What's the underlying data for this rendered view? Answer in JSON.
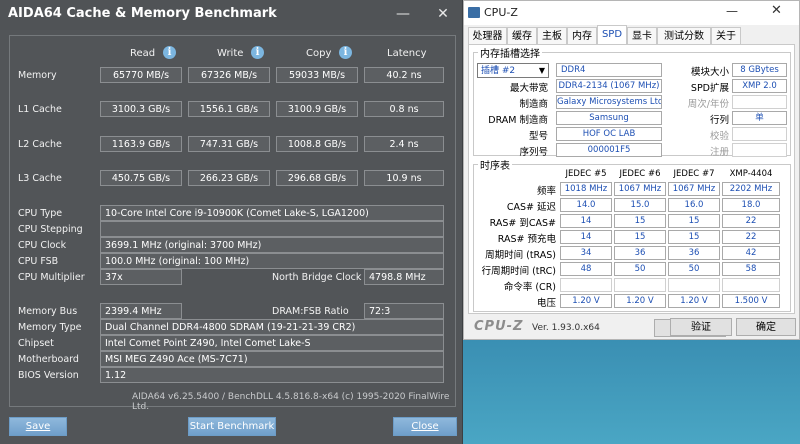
{
  "aida": {
    "title": "AIDA64 Cache & Memory Benchmark",
    "columns": {
      "read": "Read",
      "write": "Write",
      "copy": "Copy",
      "latency": "Latency"
    },
    "bench_rows": [
      {
        "label": "Memory",
        "read": "65770 MB/s",
        "write": "67326 MB/s",
        "copy": "59033 MB/s",
        "latency": "40.2 ns"
      },
      {
        "label": "L1 Cache",
        "read": "3100.3 GB/s",
        "write": "1556.1 GB/s",
        "copy": "3100.9 GB/s",
        "latency": "0.8 ns"
      },
      {
        "label": "L2 Cache",
        "read": "1163.9 GB/s",
        "write": "747.31 GB/s",
        "copy": "1008.8 GB/s",
        "latency": "2.4 ns"
      },
      {
        "label": "L3 Cache",
        "read": "450.75 GB/s",
        "write": "266.23 GB/s",
        "copy": "296.68 GB/s",
        "latency": "10.9 ns"
      }
    ],
    "cpu": {
      "type_label": "CPU Type",
      "type": "10-Core Intel Core i9-10900K  (Comet Lake-S, LGA1200)",
      "stepping_label": "CPU Stepping",
      "stepping": "",
      "clock_label": "CPU Clock",
      "clock": "3699.1 MHz  (original: 3700 MHz)",
      "fsb_label": "CPU FSB",
      "fsb": "100.0 MHz  (original: 100 MHz)",
      "mult_label": "CPU Multiplier",
      "mult": "37x",
      "nb_label": "North Bridge Clock",
      "nb": "4798.8 MHz"
    },
    "mem": {
      "bus_label": "Memory Bus",
      "bus": "2399.4 MHz",
      "ratio_label": "DRAM:FSB Ratio",
      "ratio": "72:3",
      "type_label": "Memory Type",
      "type": "Dual Channel DDR4-4800 SDRAM  (19-21-21-39 CR2)",
      "chipset_label": "Chipset",
      "chipset": "Intel Comet Point Z490, Intel Comet Lake-S",
      "mb_label": "Motherboard",
      "mb": "MSI MEG Z490 Ace (MS-7C71)",
      "bios_label": "BIOS Version",
      "bios": "1.12"
    },
    "footer": "AIDA64 v6.25.5400 / BenchDLL 4.5.816.8-x64  (c) 1995-2020 FinalWire Ltd.",
    "buttons": {
      "save": "Save",
      "start": "Start Benchmark",
      "close": "Close"
    }
  },
  "cpuz": {
    "title": "CPU-Z",
    "tabs": [
      "处理器",
      "缓存",
      "主板",
      "内存",
      "SPD",
      "显卡",
      "测试分数",
      "关于"
    ],
    "slot_group": "内存插槽选择",
    "slot_select": "插槽 #2",
    "slot_type": "DDR4",
    "module_size_label": "模块大小",
    "module_size": "8 GBytes",
    "max_bw_label": "最大带宽",
    "max_bw": "DDR4-2134 (1067 MHz)",
    "spd_ext_label": "SPD扩展",
    "spd_ext": "XMP 2.0",
    "mfr_label": "制造商",
    "mfr": "Galaxy Microsystems Ltd.",
    "week_year_label": "周次/年份",
    "dram_mfr_label": "DRAM 制造商",
    "dram_mfr": "Samsung",
    "ranks_label": "行列",
    "ranks": "单",
    "part_label": "型号",
    "part": "HOF OC LAB",
    "correction_label": "校验",
    "serial_label": "序列号",
    "serial": "000001F5",
    "registered_label": "注册",
    "timing_group": "时序表",
    "timing_cols": [
      "JEDEC #5",
      "JEDEC #6",
      "JEDEC #7",
      "XMP-4404"
    ],
    "timing_rows": [
      {
        "label": "频率",
        "vals": [
          "1018 MHz",
          "1067 MHz",
          "1067 MHz",
          "2202 MHz"
        ]
      },
      {
        "label": "CAS# 延迟",
        "vals": [
          "14.0",
          "15.0",
          "16.0",
          "18.0"
        ]
      },
      {
        "label": "RAS# 到CAS#",
        "vals": [
          "14",
          "15",
          "15",
          "22"
        ]
      },
      {
        "label": "RAS# 预充电",
        "vals": [
          "14",
          "15",
          "15",
          "22"
        ]
      },
      {
        "label": "周期时间 (tRAS)",
        "vals": [
          "34",
          "36",
          "36",
          "42"
        ]
      },
      {
        "label": "行周期时间 (tRC)",
        "vals": [
          "48",
          "50",
          "50",
          "58"
        ]
      },
      {
        "label": "命令率 (CR)",
        "vals": [
          "",
          "",
          "",
          ""
        ]
      },
      {
        "label": "电压",
        "vals": [
          "1.20 V",
          "1.20 V",
          "1.20 V",
          "1.500 V"
        ]
      }
    ],
    "brand": "CPU-Z",
    "version": "Ver. 1.93.0.x64",
    "tools_btn": "工具",
    "validate_btn": "验证",
    "ok_btn": "确定"
  }
}
